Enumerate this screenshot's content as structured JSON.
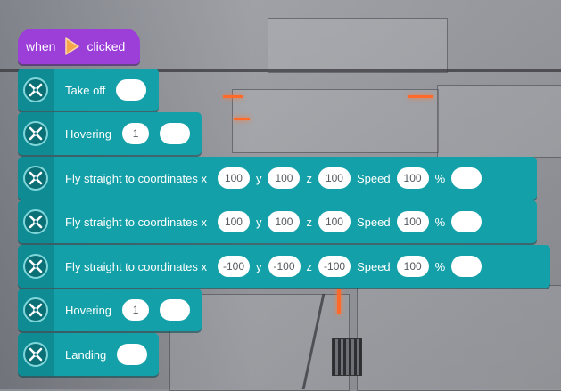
{
  "event": {
    "when": "when",
    "clicked": "clicked",
    "flag_icon": "play-flag-icon",
    "color": "#9b3fd8"
  },
  "block_color": "#13a0a8",
  "blocks": [
    {
      "label": "Take off"
    },
    {
      "label": "Hovering",
      "value": "1"
    },
    {
      "label": "Fly straight to coordinates x",
      "x": "100",
      "y_label": "y",
      "y": "100",
      "z_label": "z",
      "z": "100",
      "speed_label": "Speed",
      "speed": "100",
      "pct": "%"
    },
    {
      "label": "Fly straight to coordinates x",
      "x": "100",
      "y_label": "y",
      "y": "100",
      "z_label": "z",
      "z": "100",
      "speed_label": "Speed",
      "speed": "100",
      "pct": "%"
    },
    {
      "label": "Fly straight to coordinates x",
      "x": "-100",
      "y_label": "y",
      "y": "-100",
      "z_label": "z",
      "z": "-100",
      "speed_label": "Speed",
      "speed": "100",
      "pct": "%"
    },
    {
      "label": "Hovering",
      "value": "1"
    },
    {
      "label": "Landing"
    }
  ]
}
